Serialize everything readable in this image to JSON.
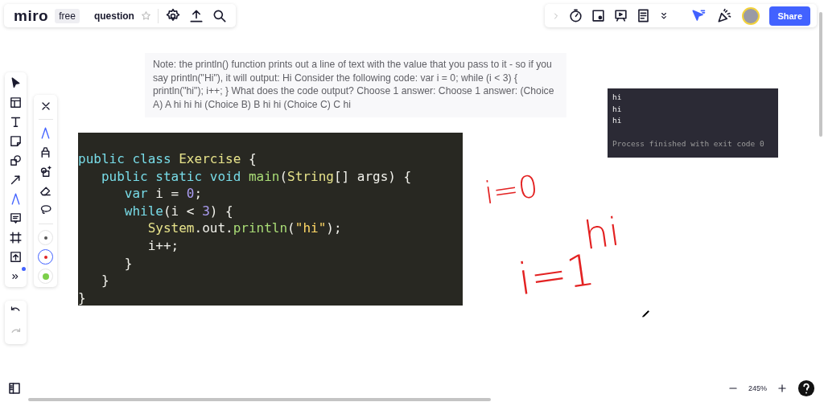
{
  "top_bar": {
    "logo": "miro",
    "plan": "free",
    "board_title": "question",
    "starred": false,
    "share_button": "Share"
  },
  "right_tools": [
    {
      "kind": "timer"
    },
    {
      "kind": "card"
    },
    {
      "kind": "present"
    },
    {
      "kind": "notes"
    },
    {
      "kind": "more"
    }
  ],
  "tools": [
    {
      "kind": "select",
      "selected": false
    },
    {
      "kind": "template",
      "selected": false
    },
    {
      "kind": "text",
      "selected": false
    },
    {
      "kind": "sticky",
      "selected": false
    },
    {
      "kind": "shapes",
      "selected": false
    },
    {
      "kind": "line",
      "selected": false
    },
    {
      "kind": "pen",
      "selected": true
    },
    {
      "kind": "comment",
      "selected": false
    },
    {
      "kind": "frame",
      "selected": false
    },
    {
      "kind": "upload",
      "selected": false
    },
    {
      "kind": "more",
      "selected": false
    }
  ],
  "pen_palette": {
    "pens": [
      {
        "kind": "pen",
        "selected": true
      },
      {
        "kind": "marker",
        "selected": false
      },
      {
        "kind": "shape_pen",
        "selected": false
      },
      {
        "kind": "eraser",
        "selected": false
      },
      {
        "kind": "lasso",
        "selected": false
      }
    ],
    "colors": [
      {
        "color": "#555555",
        "selected": false
      },
      {
        "color": "#e02424",
        "selected": true
      },
      {
        "color": "#7ccf4a",
        "selected": false
      }
    ]
  },
  "note": "Note: the println() function prints out a line of text with the value that you pass to it - so if you say println(\"Hi\"), it will output: Hi Consider the following code: var i = 0; while (i < 3) { println(\"hi\"); i++; } What does the code output? Choose 1 answer: Choose 1 answer: (Choice A) A hi hi hi (Choice B) B hi hi (Choice C) C hi",
  "code_block": {
    "lines": [
      [
        {
          "text": "public class ",
          "kind": "keyword"
        },
        {
          "text": "Exercise",
          "kind": "type"
        },
        {
          "text": " {",
          "kind": "plain"
        }
      ],
      [
        {
          "text": "   public static void ",
          "kind": "keyword"
        },
        {
          "text": "main",
          "kind": "function"
        },
        {
          "text": "(",
          "kind": "plain"
        },
        {
          "text": "String",
          "kind": "type"
        },
        {
          "text": "[] args) {",
          "kind": "plain"
        }
      ],
      [
        {
          "text": "      var ",
          "kind": "keyword"
        },
        {
          "text": "i = ",
          "kind": "plain"
        },
        {
          "text": "0",
          "kind": "number"
        },
        {
          "text": ";",
          "kind": "plain"
        }
      ],
      [
        {
          "text": "      while",
          "kind": "keyword"
        },
        {
          "text": "(i < ",
          "kind": "plain"
        },
        {
          "text": "3",
          "kind": "number"
        },
        {
          "text": ") {",
          "kind": "plain"
        }
      ],
      [
        {
          "text": "         System",
          "kind": "type"
        },
        {
          "text": ".out.",
          "kind": "plain"
        },
        {
          "text": "println",
          "kind": "function"
        },
        {
          "text": "(",
          "kind": "plain"
        },
        {
          "text": "\"hi\"",
          "kind": "string"
        },
        {
          "text": ");",
          "kind": "plain"
        }
      ],
      [
        {
          "text": "         i++;",
          "kind": "plain"
        }
      ],
      [
        {
          "text": "      }",
          "kind": "plain"
        }
      ],
      [
        {
          "text": "   }",
          "kind": "plain"
        }
      ],
      [
        {
          "text": "}",
          "kind": "plain"
        }
      ]
    ]
  },
  "console": {
    "lines": [
      {
        "text": "hi",
        "kind": "output"
      },
      {
        "text": "hi",
        "kind": "output"
      },
      {
        "text": "hi",
        "kind": "output"
      },
      {
        "kind": "blank"
      },
      {
        "text": "Process finished with exit code 0",
        "kind": "status"
      }
    ]
  },
  "handwriting": [
    {
      "text": "i=0"
    },
    {
      "text": "hi"
    },
    {
      "text": "i=1"
    }
  ],
  "zoom": {
    "level_text": "245%"
  }
}
